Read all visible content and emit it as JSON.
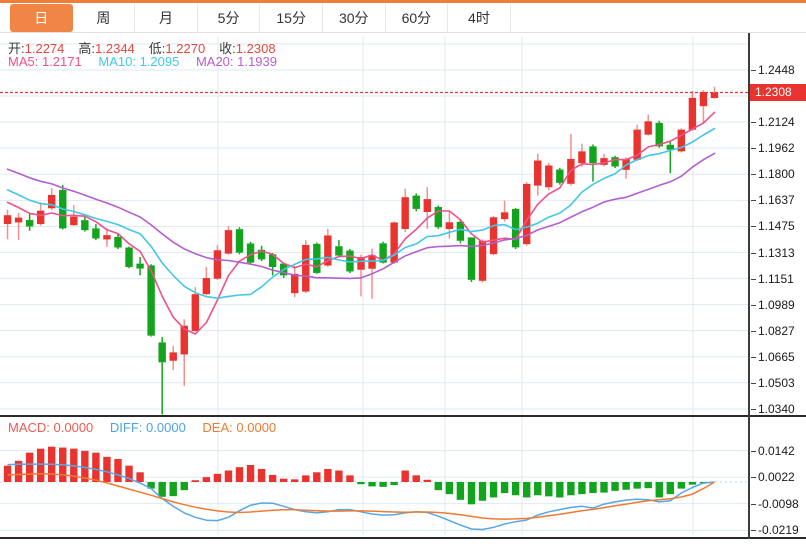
{
  "tabs": [
    {
      "name": "tab-day",
      "label": "日",
      "active": true
    },
    {
      "name": "tab-week",
      "label": "周",
      "active": false
    },
    {
      "name": "tab-month",
      "label": "月",
      "active": false
    },
    {
      "name": "tab-5min",
      "label": "5分",
      "active": false
    },
    {
      "name": "tab-15min",
      "label": "15分",
      "active": false
    },
    {
      "name": "tab-30min",
      "label": "30分",
      "active": false
    },
    {
      "name": "tab-60min",
      "label": "60分",
      "active": false
    },
    {
      "name": "tab-4hour",
      "label": "4时",
      "active": false
    }
  ],
  "ohlc": {
    "open_label": "开:",
    "open": "1.2274",
    "high_label": "高:",
    "high": "1.2344",
    "low_label": "低:",
    "low": "1.2270",
    "close_label": "收:",
    "close": "1.2308"
  },
  "ma": {
    "ma5_label": "MA5:",
    "ma5": "1.2171",
    "ma10_label": "MA10:",
    "ma10": "1.2095",
    "ma20_label": "MA20:",
    "ma20": "1.1939"
  },
  "macd_info": {
    "macd_label": "MACD:",
    "macd": "0.0000",
    "diff_label": "DIFF:",
    "diff": "0.0000",
    "dea_label": "DEA:",
    "dea": "0.0000"
  },
  "price_tag": "1.2308",
  "colors": {
    "up": "#e8332e",
    "down": "#13a41e",
    "up_wick": "rgba(233,57,48,0.55)",
    "ma5": "#f0508c",
    "ma10": "#41c8e6",
    "ma20": "#b45fd0",
    "diff_line": "#55a8e8",
    "dea_line": "#f07a30",
    "accent_orange": "#f08546",
    "tag_bg": "#e8332e",
    "grid": "#dfeaf4",
    "dotted_price": "#e8332e",
    "zero_dotted": "#bfe2f0"
  },
  "chart_data": {
    "type": "candlestick",
    "ylabel": "price",
    "current_price": 1.2308,
    "y_axis_range": [
      1.034,
      1.2448
    ],
    "y_ticks": [
      {
        "label": "1.2448",
        "value": 1.2448
      },
      {
        "label": "1.2124",
        "value": 1.2124
      },
      {
        "label": "1.1962",
        "value": 1.1962
      },
      {
        "label": "1.1800",
        "value": 1.18
      },
      {
        "label": "1.1637",
        "value": 1.1637
      },
      {
        "label": "1.1475",
        "value": 1.1475
      },
      {
        "label": "1.1313",
        "value": 1.1313
      },
      {
        "label": "1.1151",
        "value": 1.1151
      },
      {
        "label": "1.0989",
        "value": 1.0989
      },
      {
        "label": "1.0827",
        "value": 1.0827
      },
      {
        "label": "1.0665",
        "value": 1.0665
      },
      {
        "label": "1.0503",
        "value": 1.0503
      },
      {
        "label": "1.0340",
        "value": 1.034
      }
    ],
    "y_gridlines": [
      1.261,
      1.2448,
      1.2286,
      1.2124,
      1.1962,
      1.18,
      1.1637,
      1.1475,
      1.1313,
      1.1151,
      1.0989,
      1.0827,
      1.0665,
      1.0503,
      1.034
    ],
    "ma_periods": [
      5,
      10,
      20
    ],
    "ma_seed_closes": [
      1.205,
      1.203,
      1.201,
      1.199,
      1.197,
      1.195,
      1.193,
      1.191,
      1.189,
      1.187,
      1.184,
      1.181,
      1.178,
      1.175,
      1.172,
      1.169,
      1.166,
      1.163,
      1.16
    ],
    "candles": [
      [
        1.149,
        1.158,
        1.1395,
        1.1545
      ],
      [
        1.15,
        1.156,
        1.139,
        1.153
      ],
      [
        1.1515,
        1.1552,
        1.1448,
        1.1475
      ],
      [
        1.149,
        1.1625,
        1.148,
        1.1573
      ],
      [
        1.1588,
        1.1713,
        1.1577,
        1.1671
      ],
      [
        1.1702,
        1.1733,
        1.1456,
        1.1463
      ],
      [
        1.1483,
        1.1608,
        1.1478,
        1.1536
      ],
      [
        1.1514,
        1.1545,
        1.1443,
        1.1452
      ],
      [
        1.1463,
        1.149,
        1.139,
        1.14
      ],
      [
        1.1394,
        1.1463,
        1.1348,
        1.1421
      ],
      [
        1.141,
        1.143,
        1.1335,
        1.1344
      ],
      [
        1.1344,
        1.135,
        1.1215,
        1.1223
      ],
      [
        1.1244,
        1.1285,
        1.1171,
        1.1213
      ],
      [
        1.1233,
        1.124,
        1.079,
        1.0796
      ],
      [
        1.0754,
        1.0787,
        1.0306,
        1.063
      ],
      [
        1.064,
        1.0733,
        1.0583,
        1.0692
      ],
      [
        1.0679,
        1.0898,
        1.0483,
        1.0858
      ],
      [
        1.0825,
        1.1098,
        1.082,
        1.1054
      ],
      [
        1.1054,
        1.1223,
        1.1048,
        1.1154
      ],
      [
        1.115,
        1.1358,
        1.1142,
        1.1327
      ],
      [
        1.1306,
        1.1477,
        1.13,
        1.1452
      ],
      [
        1.1458,
        1.147,
        1.1302,
        1.1312
      ],
      [
        1.1369,
        1.138,
        1.124,
        1.125
      ],
      [
        1.133,
        1.1355,
        1.126,
        1.127
      ],
      [
        1.1302,
        1.131,
        1.1171,
        1.1223
      ],
      [
        1.1244,
        1.125,
        1.1155,
        1.1171
      ],
      [
        1.106,
        1.123,
        1.1035,
        1.118
      ],
      [
        1.107,
        1.139,
        1.106,
        1.136
      ],
      [
        1.1367,
        1.1375,
        1.118,
        1.1186
      ],
      [
        1.1232,
        1.146,
        1.1225,
        1.1419
      ],
      [
        1.1352,
        1.139,
        1.1285,
        1.1294
      ],
      [
        1.1325,
        1.1335,
        1.1185,
        1.1195
      ],
      [
        1.1206,
        1.13,
        1.104,
        1.1285
      ],
      [
        1.1212,
        1.1338,
        1.1025,
        1.1296
      ],
      [
        1.137,
        1.138,
        1.1245,
        1.125
      ],
      [
        1.125,
        1.1505,
        1.1242,
        1.15
      ],
      [
        1.1459,
        1.1709,
        1.144,
        1.1657
      ],
      [
        1.1667,
        1.168,
        1.157,
        1.1584
      ],
      [
        1.1565,
        1.172,
        1.146,
        1.1645
      ],
      [
        1.1596,
        1.1605,
        1.146,
        1.147
      ],
      [
        1.1459,
        1.1573,
        1.14,
        1.1501
      ],
      [
        1.1504,
        1.1515,
        1.137,
        1.1386
      ],
      [
        1.1407,
        1.141,
        1.113,
        1.1143
      ],
      [
        1.1137,
        1.1395,
        1.1125,
        1.1386
      ],
      [
        1.1303,
        1.154,
        1.1295,
        1.1532
      ],
      [
        1.1521,
        1.1635,
        1.1505,
        1.1563
      ],
      [
        1.1584,
        1.159,
        1.1335,
        1.1345
      ],
      [
        1.1365,
        1.175,
        1.1355,
        1.174
      ],
      [
        1.1729,
        1.1927,
        1.1667,
        1.1885
      ],
      [
        1.1719,
        1.187,
        1.17,
        1.1854
      ],
      [
        1.1829,
        1.184,
        1.1735,
        1.1746
      ],
      [
        1.174,
        1.205,
        1.173,
        1.1895
      ],
      [
        1.1869,
        1.199,
        1.1845,
        1.1942
      ],
      [
        1.1973,
        1.1985,
        1.1754,
        1.1869
      ],
      [
        1.1858,
        1.1925,
        1.1848,
        1.19
      ],
      [
        1.1906,
        1.1915,
        1.1838,
        1.1848
      ],
      [
        1.1827,
        1.1905,
        1.1772,
        1.1894
      ],
      [
        1.1889,
        1.2108,
        1.1882,
        1.2077
      ],
      [
        1.2046,
        1.2171,
        1.204,
        1.2129
      ],
      [
        1.2119,
        1.2132,
        1.1965,
        1.1973
      ],
      [
        1.1983,
        1.2,
        1.1806,
        1.1952
      ],
      [
        1.1942,
        1.2086,
        1.1935,
        1.2077
      ],
      [
        1.2077,
        1.2317,
        1.207,
        1.2275
      ],
      [
        1.2223,
        1.2322,
        1.2119,
        1.2311
      ],
      [
        1.2274,
        1.2344,
        1.227,
        1.2308
      ]
    ],
    "macd": {
      "type": "bar",
      "y_ticks": [
        {
          "label": "0.0142",
          "value": 0.0142
        },
        {
          "label": "0.0022",
          "value": 0.0022
        },
        {
          "label": "-0.0098",
          "value": -0.0098
        },
        {
          "label": "-0.0219",
          "value": -0.0219
        }
      ],
      "bars": [
        0.0074,
        0.0096,
        0.0133,
        0.0151,
        0.016,
        0.0156,
        0.0151,
        0.0141,
        0.0133,
        0.0114,
        0.0104,
        0.0074,
        0.0044,
        -0.003,
        -0.0067,
        -0.0064,
        -0.0037,
        0.0008,
        0.0022,
        0.0037,
        0.0052,
        0.0067,
        0.0077,
        0.0059,
        0.0032,
        0.0015,
        0.0012,
        0.003,
        0.0044,
        0.0059,
        0.0052,
        0.003,
        -0.001,
        -0.002,
        -0.0022,
        -0.0014,
        0.0052,
        0.003,
        0.001,
        -0.0037,
        -0.0055,
        -0.0081,
        -0.0101,
        -0.0085,
        -0.007,
        -0.005,
        -0.006,
        -0.007,
        -0.006,
        -0.0065,
        -0.007,
        -0.006,
        -0.0055,
        -0.005,
        -0.0048,
        -0.004,
        -0.0035,
        -0.003,
        -0.0028,
        -0.007,
        -0.0055,
        -0.003,
        -0.0012,
        -0.0005,
        0.0
      ],
      "diff": [
        0.0079,
        0.008,
        0.0081,
        0.0081,
        0.008,
        0.0078,
        0.0073,
        0.0066,
        0.0057,
        0.0046,
        0.0032,
        0.0016,
        -0.0005,
        -0.003,
        -0.0075,
        -0.011,
        -0.014,
        -0.016,
        -0.0173,
        -0.0175,
        -0.016,
        -0.013,
        -0.0105,
        -0.0095,
        -0.0096,
        -0.011,
        -0.0125,
        -0.0135,
        -0.014,
        -0.0135,
        -0.0125,
        -0.0125,
        -0.0135,
        -0.0145,
        -0.015,
        -0.0148,
        -0.014,
        -0.0135,
        -0.0138,
        -0.0155,
        -0.0175,
        -0.0195,
        -0.0213,
        -0.0215,
        -0.0205,
        -0.019,
        -0.018,
        -0.0172,
        -0.015,
        -0.0135,
        -0.0125,
        -0.0115,
        -0.011,
        -0.0118,
        -0.01,
        -0.009,
        -0.0082,
        -0.0078,
        -0.008,
        -0.009,
        -0.0085,
        -0.005,
        -0.0025,
        -0.0005,
        0.0
      ],
      "dea": [
        0.0032,
        0.0034,
        0.0036,
        0.0037,
        0.0036,
        0.0032,
        0.0026,
        0.0018,
        0.0008,
        -0.0004,
        -0.0018,
        -0.0032,
        -0.0046,
        -0.006,
        -0.0075,
        -0.009,
        -0.0103,
        -0.0114,
        -0.0123,
        -0.0131,
        -0.0136,
        -0.0138,
        -0.0136,
        -0.0132,
        -0.0128,
        -0.0126,
        -0.0126,
        -0.0128,
        -0.013,
        -0.0132,
        -0.0132,
        -0.0131,
        -0.0131,
        -0.0132,
        -0.0134,
        -0.0136,
        -0.0137,
        -0.0136,
        -0.0136,
        -0.0138,
        -0.0142,
        -0.0148,
        -0.0156,
        -0.0163,
        -0.0167,
        -0.0168,
        -0.0167,
        -0.0165,
        -0.016,
        -0.0153,
        -0.0146,
        -0.0138,
        -0.013,
        -0.0124,
        -0.0116,
        -0.0108,
        -0.01,
        -0.0092,
        -0.0085,
        -0.008,
        -0.0076,
        -0.0068,
        -0.0055,
        -0.003,
        0.0
      ]
    }
  }
}
